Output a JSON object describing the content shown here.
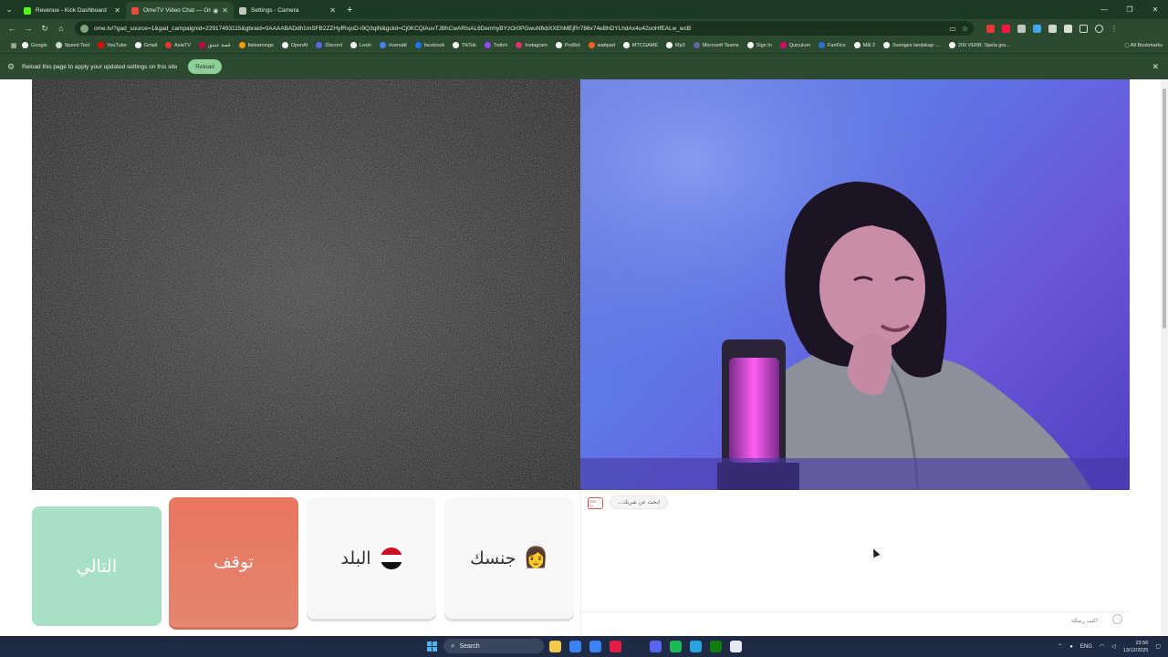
{
  "browser": {
    "tabs": [
      {
        "title": "Revenue - Kick Dashboard",
        "favicon_color": "#53fc18",
        "active": false
      },
      {
        "title": "OmeTV Video Chat — Ome",
        "favicon_color": "#e94b3c",
        "active": true
      },
      {
        "title": "Settings - Camera",
        "favicon_color": "#bfc7bf",
        "active": false
      }
    ],
    "new_tab_label": "+",
    "url": "ome.tv/?gad_source=1&gad_campaignid=22917493115&gbraid=0AAAABADdh1mSFB2ZZHyfRxjoD-i9Q3qlN&gclid=Cj0KCQiAuvTJBhCwARIsAL6DemhyBYzOr0PGwuNfkbXXEhMEjRr786x74eBhDYLhdAx4u42ooHfEALw_wcB",
    "bookmarks": [
      {
        "label": "Google",
        "color": "#ffffff"
      },
      {
        "label": "Speed Test",
        "color": "#cfd8cf"
      },
      {
        "label": "YouTube",
        "color": "#ff0000"
      },
      {
        "label": "Gmail",
        "color": "#ffffff"
      },
      {
        "label": "AsiaTV",
        "color": "#e33"
      },
      {
        "label": "قصة عشق",
        "color": "#c04"
      },
      {
        "label": "Itslearnings",
        "color": "#f90"
      },
      {
        "label": "OpenAI",
        "color": "#ffffff"
      },
      {
        "label": "Discord",
        "color": "#5865f2"
      },
      {
        "label": "Lexin",
        "color": "#ffffff"
      },
      {
        "label": "översätt",
        "color": "#4285f4"
      },
      {
        "label": "facebook",
        "color": "#1877f2"
      },
      {
        "label": "TikTok",
        "color": "#ffffff"
      },
      {
        "label": "Twitch",
        "color": "#9146ff"
      },
      {
        "label": "Instagram",
        "color": "#e1306c"
      },
      {
        "label": "ProBot",
        "color": "#ffffff"
      },
      {
        "label": "wattpad",
        "color": "#ff6122"
      },
      {
        "label": "MTCGAME",
        "color": "#ffffff"
      },
      {
        "label": "Mp3",
        "color": "#ffffff"
      },
      {
        "label": "Microsoft Teams",
        "color": "#6264a7"
      },
      {
        "label": "Sign In",
        "color": "#ffffff"
      },
      {
        "label": "Quiculum",
        "color": "#e3006b"
      },
      {
        "label": "FanFics",
        "color": "#2a6fd6"
      },
      {
        "label": "Mål 2",
        "color": "#ffffff"
      },
      {
        "label": "Sveriges landskap -...",
        "color": "#ffffff"
      },
      {
        "label": "200 VERB: Spela gra...",
        "color": "#ffffff"
      }
    ],
    "all_bookmarks_label": "All Bookmarks",
    "infobar": {
      "message": "Reload this page to apply your updated settings on this site",
      "button": "Reload"
    }
  },
  "app": {
    "buttons": {
      "next": "التالي",
      "stop": "توقف",
      "country": "البلد",
      "gender": "جنسك",
      "gender_emoji": "👩"
    },
    "chat": {
      "logo": "OME TV",
      "bubble": "...ابحث عن شريك",
      "input_placeholder": "اكتب رسالة"
    }
  },
  "taskbar": {
    "search_label": "Search",
    "lang": "ENG",
    "time": "23:56",
    "date": "13/12/2025",
    "app_colors": [
      "#f2c94c",
      "#3b82f6",
      "#3b82f6",
      "#e11d48",
      "#1f2a44",
      "#5865f2",
      "#1db954",
      "#2aa3df",
      "#107c10",
      "#e6e9ef"
    ]
  }
}
